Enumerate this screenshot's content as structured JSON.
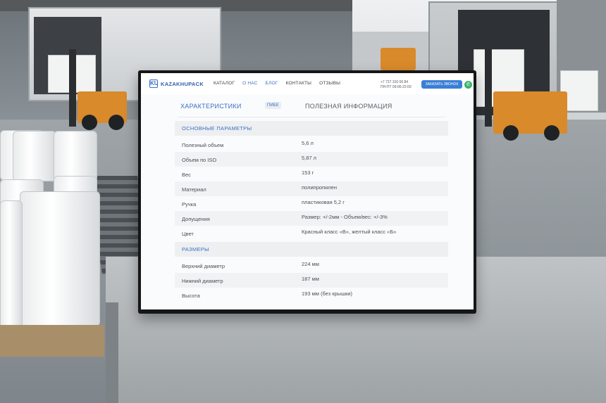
{
  "nav": {
    "logo_text": "KAZAKHUPACK",
    "logo_mark": "KU",
    "items": [
      {
        "label": "КАТАЛОГ",
        "active": false
      },
      {
        "label": "О НАС",
        "active": true
      },
      {
        "label": "БЛОГ",
        "active": true
      },
      {
        "label": "КОНТАКТЫ",
        "active": false
      },
      {
        "label": "ОТЗЫВЫ",
        "active": false
      }
    ],
    "phone": "+7 727 310 06 84",
    "hours": "ПН-ПТ 09:00-22:00",
    "call_button": "ЗАКАЗАТЬ ЗВОНОК",
    "whatsapp_icon": "whatsapp-icon"
  },
  "tabs": {
    "characteristics": "ХАРАКТЕРИСТИКИ",
    "badge": "ПИБЕ",
    "useful_info": "ПОЛЕЗНАЯ ИНФОРМАЦИЯ"
  },
  "sections": {
    "main_params": {
      "title": "ОСНОВНЫЕ ПАРАМЕТРЫ",
      "rows": [
        {
          "key": "Полезный объем",
          "value": "5,6 л"
        },
        {
          "key": "Объем по ISO",
          "value": "5,87 л"
        },
        {
          "key": "Вес",
          "value": "153 г"
        },
        {
          "key": "Материал",
          "value": "полипропилен"
        },
        {
          "key": "Ручка",
          "value": "пластиковая 5,2 г"
        },
        {
          "key": "Допущения",
          "value": "Размер: +/-2мм - Объем/вес: +/-3%"
        },
        {
          "key": "Цвет",
          "value": "Красный класс «В», желтый класс «Б»"
        }
      ]
    },
    "dimensions": {
      "title": "РАЗМЕРЫ",
      "rows": [
        {
          "key": "Верхний диаметр",
          "value": "224 мм"
        },
        {
          "key": "Нижний диаметр",
          "value": "187 мм"
        },
        {
          "key": "Высота",
          "value": "193 мм (без крышки)"
        }
      ]
    }
  }
}
